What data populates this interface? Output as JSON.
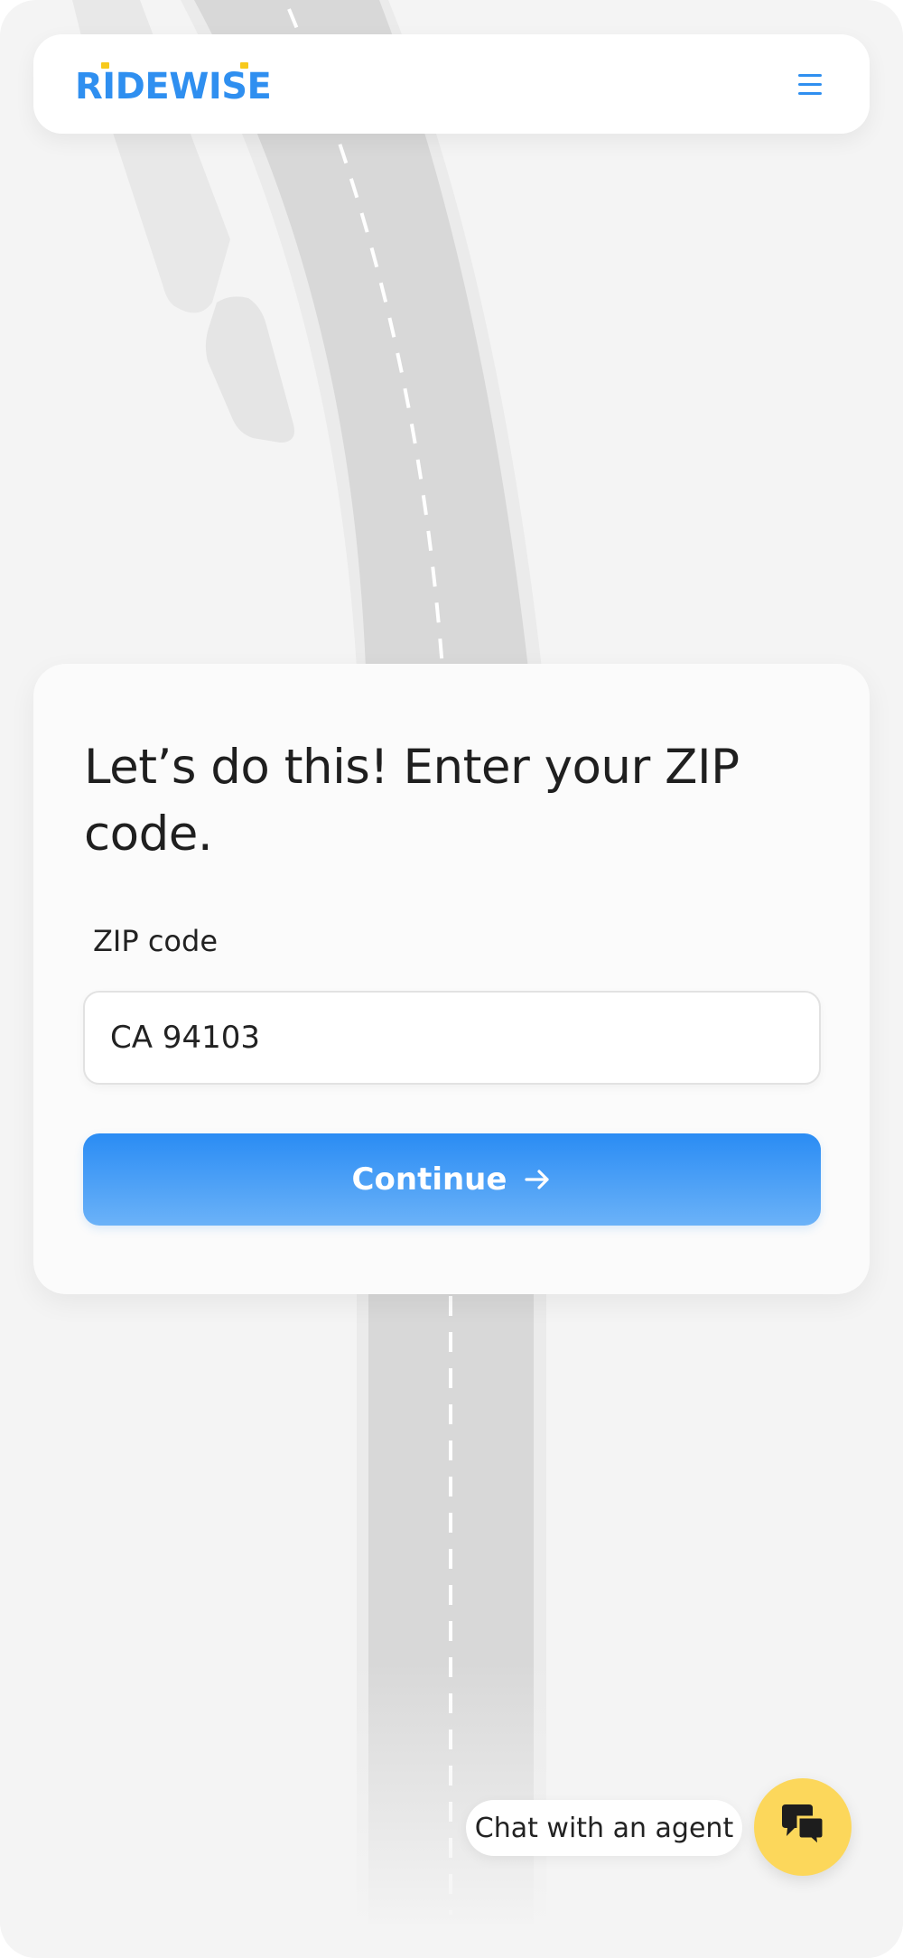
{
  "brand": {
    "name": "RIDEWISE",
    "primary_color": "#2f8ff0",
    "accent_color": "#f7c91c"
  },
  "header": {
    "menu_icon": "hamburger-menu-icon"
  },
  "form": {
    "title": "Let’s do this! Enter your ZIP code.",
    "zip_label": "ZIP code",
    "zip_value": "CA 94103",
    "continue_label": "Continue",
    "continue_icon": "arrow-right-icon"
  },
  "chat": {
    "label": "Chat with an agent",
    "icon": "chat-bubbles-icon",
    "color": "#fcd75b"
  }
}
